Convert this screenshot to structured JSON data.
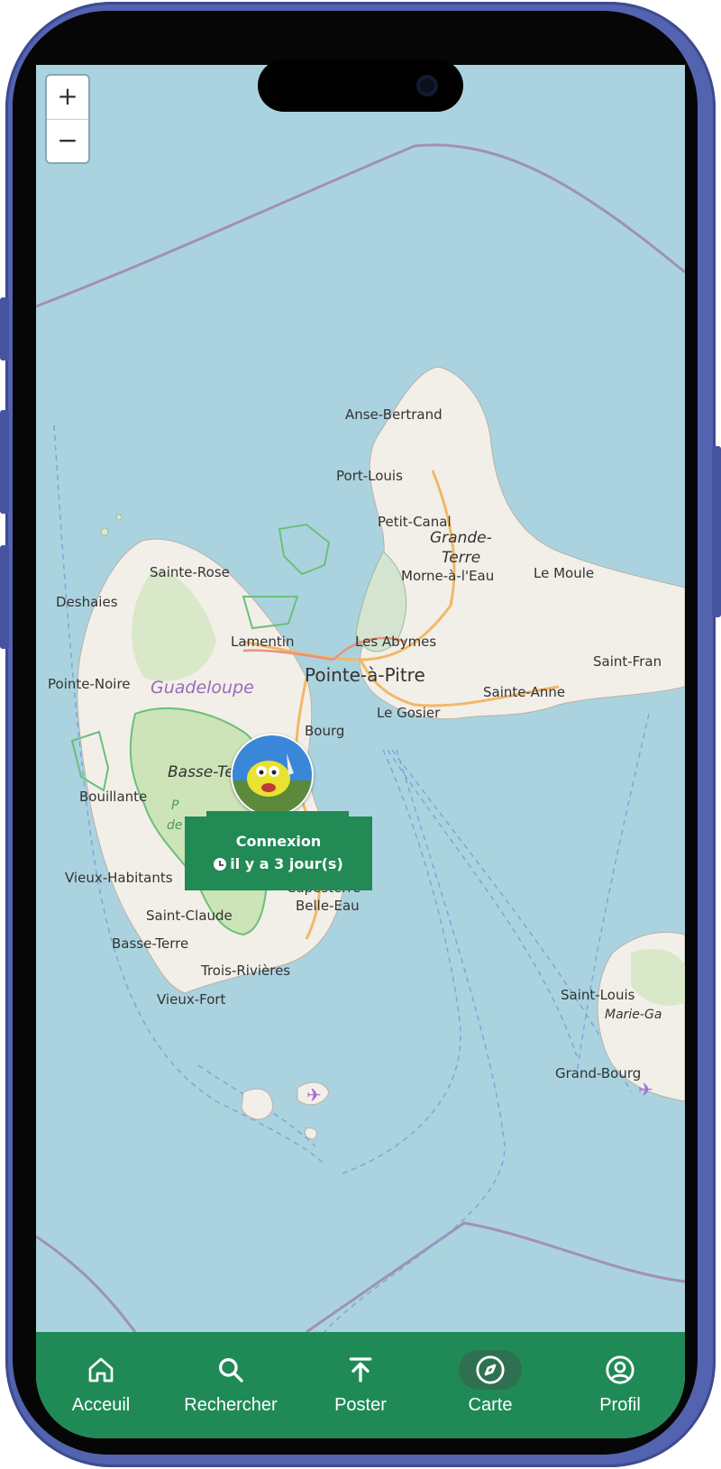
{
  "map": {
    "zoom_in": "+",
    "zoom_out": "−",
    "labels": {
      "anse_bertrand": "Anse-Bertrand",
      "port_louis": "Port-Louis",
      "petit_canal": "Petit-Canal",
      "grande": "Grande-",
      "terre": "Terre",
      "morne_a_leau": "Morne-à-l'Eau",
      "le_moule": "Le Moule",
      "sainte_rose": "Sainte-Rose",
      "deshaies": "Deshaies",
      "lamentin": "Lamentin",
      "les_abymes": "Les Abymes",
      "pointe_a_pitre": "Pointe-à-Pitre",
      "saint_fran": "Saint-Fran",
      "pointe_noire": "Pointe-Noire",
      "guadeloupe": "Guadeloupe",
      "sainte_anne": "Sainte-Anne",
      "bourg": "Bourg",
      "le_gosier": "Le Gosier",
      "basse_ter": "Basse-Ter",
      "bouillante": "Bouillante",
      "vieux_habitants": "Vieux-Habitants",
      "capesterre": "Capesterre-",
      "belle_eau": "Belle-Eau",
      "saint_claude": "Saint-Claude",
      "basse_terre": "Basse-Terre",
      "trois_rivieres": "Trois-Rivières",
      "vieux_fort": "Vieux-Fort",
      "saint_louis": "Saint-Louis",
      "marie_ga": "Marie-Ga",
      "grand_bourg": "Grand-Bourg",
      "p": "P",
      "de": "de"
    }
  },
  "popup": {
    "title": "Connexion",
    "time": "il y a 3 jour(s)"
  },
  "nav": {
    "items": [
      {
        "label": "Acceuil",
        "icon": "home-icon"
      },
      {
        "label": "Rechercher",
        "icon": "search-icon"
      },
      {
        "label": "Poster",
        "icon": "upload-icon"
      },
      {
        "label": "Carte",
        "icon": "compass-icon",
        "active": true
      },
      {
        "label": "Profil",
        "icon": "profile-icon"
      }
    ]
  },
  "colors": {
    "accent": "#208a57",
    "sea": "#abd3df",
    "land": "#f2efe9",
    "forest": "#cde4b8",
    "phone_frame": "#5363b0"
  }
}
